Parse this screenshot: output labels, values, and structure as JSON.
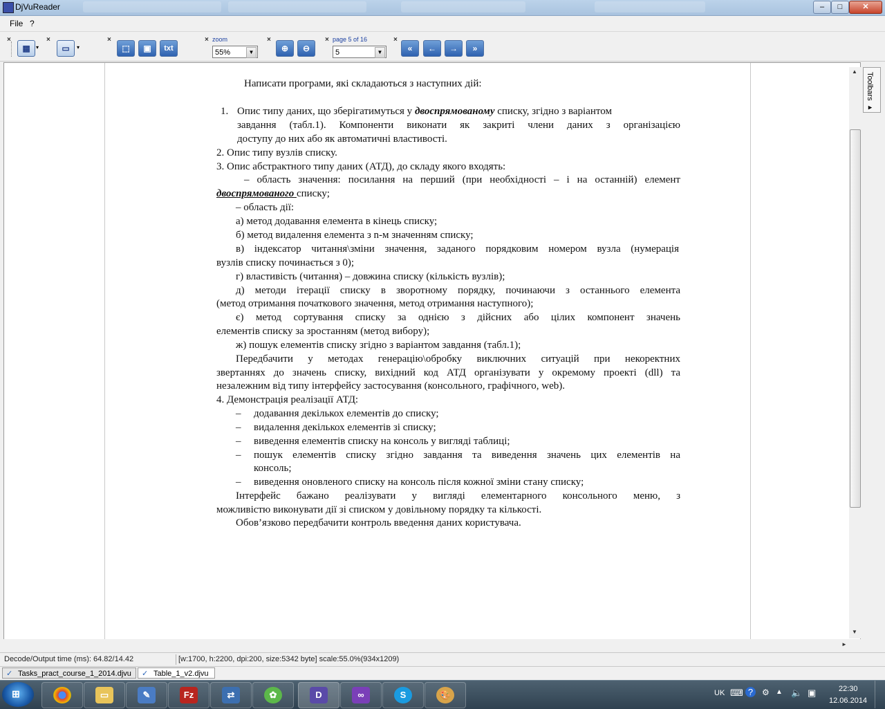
{
  "window": {
    "title": "DjVuReader",
    "minimize": "–",
    "maximize": "□",
    "close": "✕"
  },
  "menu": [
    "File",
    "?"
  ],
  "toolbar": {
    "zoom_label": "zoom",
    "zoom_value": "55%",
    "page_label": "page 5 of 16",
    "page_value": "5",
    "text_button": "txt",
    "icons": [
      "view-mode-icon",
      "page-layout-icon",
      "select-rect-icon",
      "image-mode-icon",
      "text-mode-icon",
      "zoom-in-icon",
      "zoom-out-icon",
      "first-page-icon",
      "prev-page-icon",
      "next-page-icon",
      "last-page-icon"
    ]
  },
  "side_panel": {
    "label": "Toolbars ▸"
  },
  "document": {
    "lines": [
      "Написати програми, які складаються з наступних дій:",
      "1.",
      "Опис типу даних, що зберігатимуться у ",
      "двоспрямованому",
      " списку, згідно з варіантом",
      "завдання (табл.1). Компоненти виконати як закриті члени даних з організацією",
      "доступу до них або як автоматичні властивості.",
      "2.   Опис типу вузлів списку.",
      "3.   Опис абстрактного типу даних (АТД), до складу якого входять:",
      "– область значення: посилання на перший (при необхідності – і на останній) елемент",
      "двоспрямованого ",
      "списку;",
      "– область дії:",
      "а) метод додавання елемента в кінець списку;",
      "б) метод видалення елемента з n-м  значенням списку;",
      "в) індексатор читання\\зміни значення, заданого порядковим номером вузла (нумерація",
      "вузлів списку починається з 0);",
      "г) властивість (читання) – довжина списку (кількість вузлів);",
      "д) методи ітерації списку в зворотному порядку, починаючи з останнього елемента",
      "(метод отримання початкового значення, метод отримання наступного);",
      "є) метод сортування списку за однією з дійсних або цілих компонент значень",
      "елементів списку за зростанням (метод вибору);",
      "ж) пошук елементів списку згідно з варіантом завдання (табл.1);",
      "Передбачити у методах генерацію\\обробку виключних ситуацій при некоректних",
      "звертаннях до значень списку, вихідний код АТД організувати у окремому проекті (dll) та",
      "незалежним від типу інтерфейсу застосування (консольного, графічного, web).",
      "4.   Демонстрація реалізації АТД:",
      "–",
      "додавання декількох елементів до списку;",
      "видалення декількох елементів зі списку;",
      "виведення елементів списку на консоль у вигляді таблиці;",
      "пошук елементів списку згідно завдання та виведення значень цих елементів на",
      "консоль;",
      "виведення оновленого списку на консоль після кожної зміни стану списку;",
      "Інтерфейс бажано реалізувати у вигляді елементарного консольного меню, з",
      "можливістю виконувати дії зі списком у довільному порядку та кількості.",
      "Обов’язково передбачити контроль введення даних користувача."
    ]
  },
  "status": {
    "decode": "Decode/Output time (ms): 64.82/14.42",
    "info": "[w:1700, h:2200, dpi:200, size:5342 byte] scale:55.0%(934x1209)"
  },
  "doc_tabs": [
    "Tasks_pract_course_1_2014.djvu",
    "Table_1_v2.djvu"
  ],
  "taskbar": {
    "apps": [
      "chrome-icon",
      "explorer-icon",
      "notepad-icon",
      "filezilla-icon",
      "network-icon",
      "icq-icon",
      "djvureader-icon",
      "visual-studio-icon",
      "skype-icon",
      "paint-icon"
    ],
    "lang": "UK",
    "time": "22:30",
    "date": "12.06.2014"
  },
  "colors": {
    "titlebar": "#a9c3df",
    "taskbar": "#2f4150",
    "accent": "#2f62b0"
  }
}
